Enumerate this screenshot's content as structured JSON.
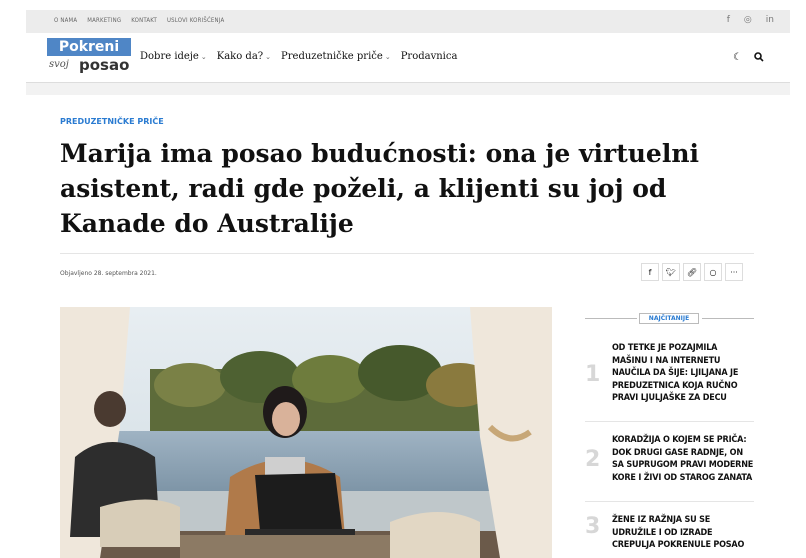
{
  "top_links": [
    "O NAMA",
    "MARKETING",
    "KONTAKT",
    "USLOVI KORIŠĆENJA"
  ],
  "social_icons": [
    "facebook-icon",
    "instagram-icon",
    "linkedin-icon"
  ],
  "logo": {
    "top": "Pokreni",
    "script": "svoj",
    "bottom": "posao"
  },
  "menu": [
    {
      "label": "Dobre ideje",
      "has_dropdown": true
    },
    {
      "label": "Kako da?",
      "has_dropdown": true
    },
    {
      "label": "Preduzetničke priče",
      "has_dropdown": true
    },
    {
      "label": "Prodavnica",
      "has_dropdown": false
    }
  ],
  "article": {
    "category": "PREDUZETNIČKE PRIČE",
    "title": "Marija ima posao budućnosti: ona je virtuelni asistent, radi gde poželi, a klijenti su joj od Kanade do Australije",
    "date": "Objavljeno 28. septembra 2021."
  },
  "share_icons": [
    "facebook-icon",
    "twitter-icon",
    "link-icon",
    "comment-icon",
    "more-icon"
  ],
  "sidebar": {
    "widget_title": "NAJČITANIJE",
    "items": [
      {
        "num": "1",
        "title": "OD TETKE JE POZAJMILA MAŠINU I NA INTERNETU NAUČILA DA ŠIJE: LJILJANA JE PREDUZETNICA KOJA RUČNO PRAVI LJULJAŠKE ZA DECU"
      },
      {
        "num": "2",
        "title": "KORADŽIJA O KOJEM SE PRIČA: DOK DRUGI GASE RADNJE, ON SA SUPRUGOM PRAVI MODERNE KORE I ŽIVI OD STAROG ZANATA"
      },
      {
        "num": "3",
        "title": "ŽENE IZ RAŽNJA SU SE UDRUŽILE I OD IZRADE CREPULJA POKRENULE POSAO"
      }
    ]
  }
}
